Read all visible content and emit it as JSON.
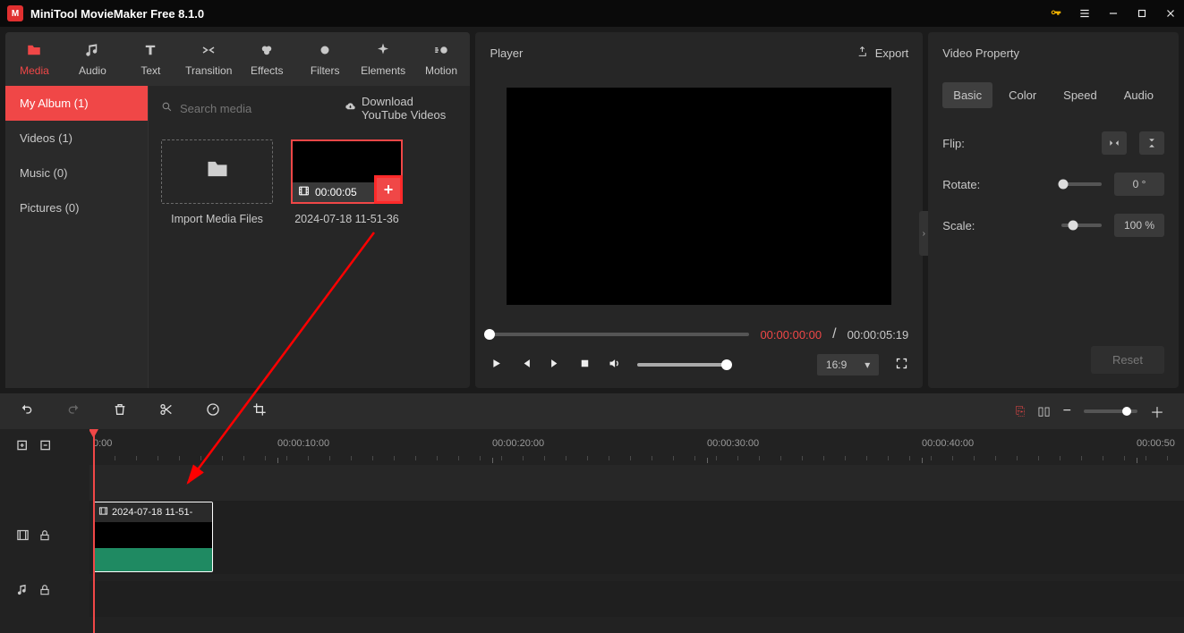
{
  "app_title": "MiniTool MovieMaker Free 8.1.0",
  "tabs": {
    "media": "Media",
    "audio": "Audio",
    "text": "Text",
    "transition": "Transition",
    "effects": "Effects",
    "filters": "Filters",
    "elements": "Elements",
    "motion": "Motion"
  },
  "sidebar": {
    "album": "My Album (1)",
    "videos": "Videos (1)",
    "music": "Music (0)",
    "pictures": "Pictures (0)"
  },
  "search_placeholder": "Search media",
  "download_yt": "Download YouTube Videos",
  "import_label": "Import Media Files",
  "clip": {
    "duration": "00:00:05",
    "name": "2024-07-18 11-51-36",
    "short": "2024-07-18 11-51-"
  },
  "player": {
    "title": "Player",
    "export": "Export",
    "current": "00:00:00:00",
    "total": "00:00:05:19",
    "aspect": "16:9"
  },
  "props": {
    "title": "Video Property",
    "tabs": {
      "basic": "Basic",
      "color": "Color",
      "speed": "Speed",
      "audio": "Audio"
    },
    "flip": "Flip:",
    "rotate": "Rotate:",
    "scale": "Scale:",
    "rotate_val": "0 °",
    "scale_val": "100 %",
    "reset": "Reset"
  },
  "ruler": [
    "0:00",
    "00:00:10:00",
    "00:00:20:00",
    "00:00:30:00",
    "00:00:40:00",
    "00:00:50"
  ]
}
